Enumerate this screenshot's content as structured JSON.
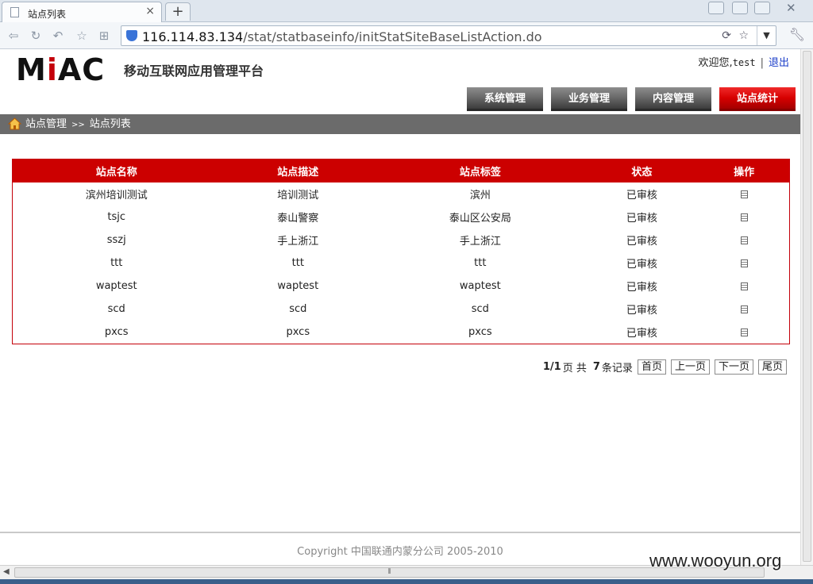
{
  "browser": {
    "tab_title": "站点列表",
    "tab_close": "×",
    "new_tab": "+",
    "url_host": "116.114.83.134",
    "url_path": "/stat/statbaseinfo/initStatSiteBaseListAction.do"
  },
  "header": {
    "logo_m": "M",
    "logo_i": "i",
    "logo_ac": "AC",
    "site_name": "移动互联网应用管理平台",
    "welcome_prefix": "欢迎您,",
    "username": "test",
    "separator": "|",
    "logout": "退出"
  },
  "nav": [
    {
      "label": "系统管理"
    },
    {
      "label": "业务管理"
    },
    {
      "label": "内容管理"
    },
    {
      "label": "站点统计"
    }
  ],
  "breadcrumb": {
    "root": "站点管理",
    "arrow": ">>",
    "current": "站点列表"
  },
  "table": {
    "headers": [
      "站点名称",
      "站点描述",
      "站点标签",
      "状态",
      "操作"
    ],
    "rows": [
      [
        "滨州培训测试",
        "培训测试",
        "滨州",
        "已审核"
      ],
      [
        "tsjc",
        "泰山警察",
        "泰山区公安局",
        "已审核"
      ],
      [
        "sszj",
        "手上浙江",
        "手上浙江",
        "已审核"
      ],
      [
        "ttt",
        "ttt",
        "ttt",
        "已审核"
      ],
      [
        "waptest",
        "waptest",
        "waptest",
        "已审核"
      ],
      [
        "scd",
        "scd",
        "scd",
        "已审核"
      ],
      [
        "pxcs",
        "pxcs",
        "pxcs",
        "已审核"
      ]
    ]
  },
  "pager": {
    "page": "1/1",
    "page_unit": "页 共",
    "count": "7",
    "count_unit": "条记录",
    "first": "首页",
    "prev": "上一页",
    "next": "下一页",
    "last": "尾页"
  },
  "footer": {
    "copyright": "Copyright 中国联通内蒙分公司 2005-2010"
  },
  "watermark": "www.wooyun.org",
  "colors": {
    "brand_red": "#cc0000",
    "nav_gray": "#6b6b6b",
    "link_blue": "#1a3cc8"
  }
}
